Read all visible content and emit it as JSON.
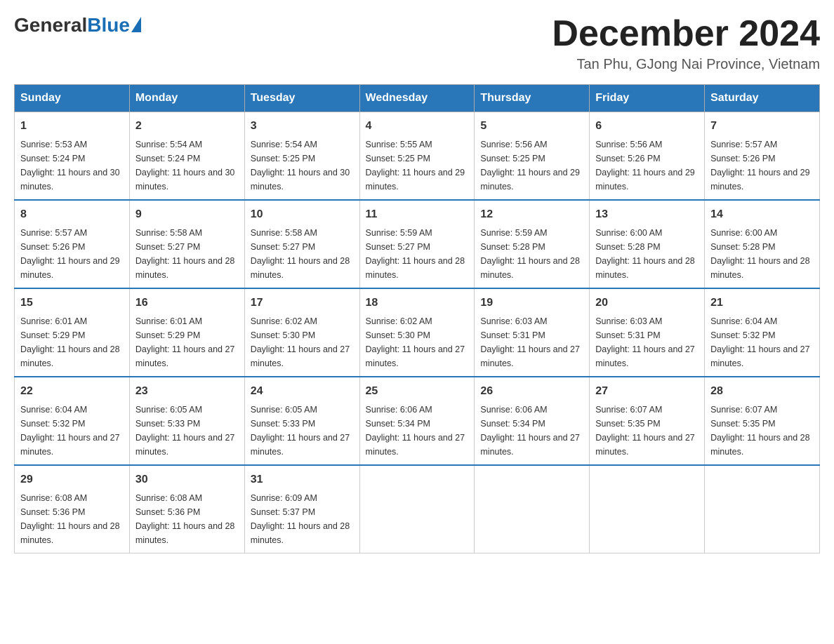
{
  "header": {
    "logo": {
      "general": "General",
      "blue": "Blue"
    },
    "title": "December 2024",
    "subtitle": "Tan Phu, GJong Nai Province, Vietnam"
  },
  "calendar": {
    "weekdays": [
      "Sunday",
      "Monday",
      "Tuesday",
      "Wednesday",
      "Thursday",
      "Friday",
      "Saturday"
    ],
    "weeks": [
      [
        {
          "day": "1",
          "sunrise": "5:53 AM",
          "sunset": "5:24 PM",
          "daylight": "11 hours and 30 minutes."
        },
        {
          "day": "2",
          "sunrise": "5:54 AM",
          "sunset": "5:24 PM",
          "daylight": "11 hours and 30 minutes."
        },
        {
          "day": "3",
          "sunrise": "5:54 AM",
          "sunset": "5:25 PM",
          "daylight": "11 hours and 30 minutes."
        },
        {
          "day": "4",
          "sunrise": "5:55 AM",
          "sunset": "5:25 PM",
          "daylight": "11 hours and 29 minutes."
        },
        {
          "day": "5",
          "sunrise": "5:56 AM",
          "sunset": "5:25 PM",
          "daylight": "11 hours and 29 minutes."
        },
        {
          "day": "6",
          "sunrise": "5:56 AM",
          "sunset": "5:26 PM",
          "daylight": "11 hours and 29 minutes."
        },
        {
          "day": "7",
          "sunrise": "5:57 AM",
          "sunset": "5:26 PM",
          "daylight": "11 hours and 29 minutes."
        }
      ],
      [
        {
          "day": "8",
          "sunrise": "5:57 AM",
          "sunset": "5:26 PM",
          "daylight": "11 hours and 29 minutes."
        },
        {
          "day": "9",
          "sunrise": "5:58 AM",
          "sunset": "5:27 PM",
          "daylight": "11 hours and 28 minutes."
        },
        {
          "day": "10",
          "sunrise": "5:58 AM",
          "sunset": "5:27 PM",
          "daylight": "11 hours and 28 minutes."
        },
        {
          "day": "11",
          "sunrise": "5:59 AM",
          "sunset": "5:27 PM",
          "daylight": "11 hours and 28 minutes."
        },
        {
          "day": "12",
          "sunrise": "5:59 AM",
          "sunset": "5:28 PM",
          "daylight": "11 hours and 28 minutes."
        },
        {
          "day": "13",
          "sunrise": "6:00 AM",
          "sunset": "5:28 PM",
          "daylight": "11 hours and 28 minutes."
        },
        {
          "day": "14",
          "sunrise": "6:00 AM",
          "sunset": "5:28 PM",
          "daylight": "11 hours and 28 minutes."
        }
      ],
      [
        {
          "day": "15",
          "sunrise": "6:01 AM",
          "sunset": "5:29 PM",
          "daylight": "11 hours and 28 minutes."
        },
        {
          "day": "16",
          "sunrise": "6:01 AM",
          "sunset": "5:29 PM",
          "daylight": "11 hours and 27 minutes."
        },
        {
          "day": "17",
          "sunrise": "6:02 AM",
          "sunset": "5:30 PM",
          "daylight": "11 hours and 27 minutes."
        },
        {
          "day": "18",
          "sunrise": "6:02 AM",
          "sunset": "5:30 PM",
          "daylight": "11 hours and 27 minutes."
        },
        {
          "day": "19",
          "sunrise": "6:03 AM",
          "sunset": "5:31 PM",
          "daylight": "11 hours and 27 minutes."
        },
        {
          "day": "20",
          "sunrise": "6:03 AM",
          "sunset": "5:31 PM",
          "daylight": "11 hours and 27 minutes."
        },
        {
          "day": "21",
          "sunrise": "6:04 AM",
          "sunset": "5:32 PM",
          "daylight": "11 hours and 27 minutes."
        }
      ],
      [
        {
          "day": "22",
          "sunrise": "6:04 AM",
          "sunset": "5:32 PM",
          "daylight": "11 hours and 27 minutes."
        },
        {
          "day": "23",
          "sunrise": "6:05 AM",
          "sunset": "5:33 PM",
          "daylight": "11 hours and 27 minutes."
        },
        {
          "day": "24",
          "sunrise": "6:05 AM",
          "sunset": "5:33 PM",
          "daylight": "11 hours and 27 minutes."
        },
        {
          "day": "25",
          "sunrise": "6:06 AM",
          "sunset": "5:34 PM",
          "daylight": "11 hours and 27 minutes."
        },
        {
          "day": "26",
          "sunrise": "6:06 AM",
          "sunset": "5:34 PM",
          "daylight": "11 hours and 27 minutes."
        },
        {
          "day": "27",
          "sunrise": "6:07 AM",
          "sunset": "5:35 PM",
          "daylight": "11 hours and 27 minutes."
        },
        {
          "day": "28",
          "sunrise": "6:07 AM",
          "sunset": "5:35 PM",
          "daylight": "11 hours and 28 minutes."
        }
      ],
      [
        {
          "day": "29",
          "sunrise": "6:08 AM",
          "sunset": "5:36 PM",
          "daylight": "11 hours and 28 minutes."
        },
        {
          "day": "30",
          "sunrise": "6:08 AM",
          "sunset": "5:36 PM",
          "daylight": "11 hours and 28 minutes."
        },
        {
          "day": "31",
          "sunrise": "6:09 AM",
          "sunset": "5:37 PM",
          "daylight": "11 hours and 28 minutes."
        },
        null,
        null,
        null,
        null
      ]
    ]
  }
}
